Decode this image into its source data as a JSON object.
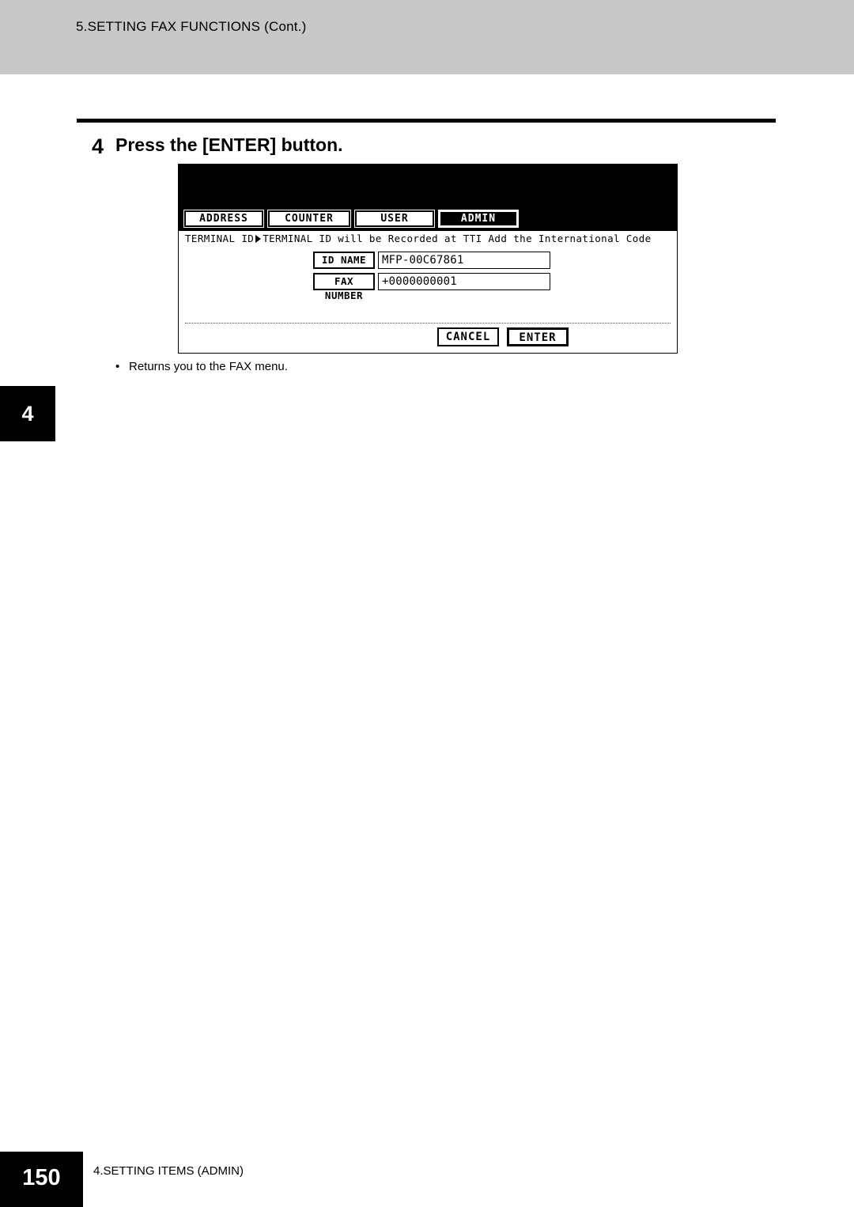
{
  "header": {
    "running_title": "5.SETTING FAX FUNCTIONS (Cont.)"
  },
  "step": {
    "number": "4",
    "heading": "Press the [ENTER] button."
  },
  "lcd": {
    "tabs": [
      {
        "label": "ADDRESS",
        "selected": false
      },
      {
        "label": "COUNTER",
        "selected": false
      },
      {
        "label": "USER",
        "selected": false
      },
      {
        "label": "ADMIN",
        "selected": true
      }
    ],
    "notice_prefix": "TERMINAL ID",
    "notice_text": "TERMINAL ID will be Recorded at TTI Add the International Code",
    "fields": [
      {
        "button_label": "ID NAME",
        "value": "MFP-00C67861"
      },
      {
        "button_label": "FAX NUMBER",
        "value": "+0000000001"
      }
    ],
    "buttons": {
      "cancel": "CANCEL",
      "enter": "ENTER"
    }
  },
  "bullet": {
    "marker": "•",
    "text": "Returns you to the FAX menu."
  },
  "side_tab": {
    "label": "4"
  },
  "footer": {
    "page_number": "150",
    "chapter": "4.SETTING ITEMS (ADMIN)"
  }
}
